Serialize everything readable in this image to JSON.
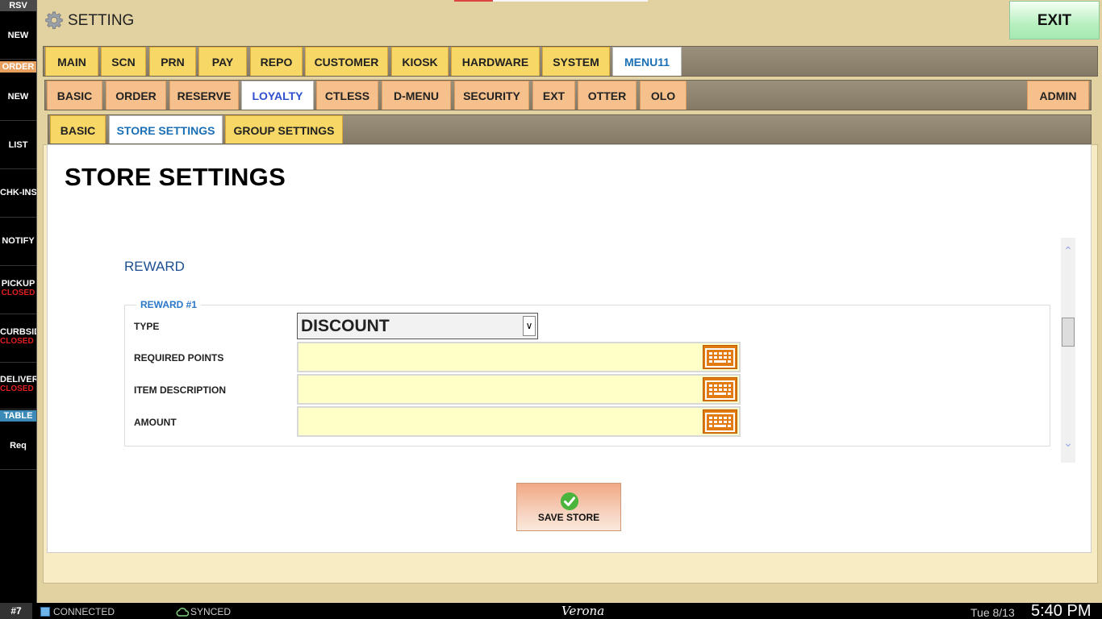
{
  "sidebar": {
    "rsv_header": "RSV",
    "rsv_new": "NEW",
    "order_header": "ORDER",
    "order_items": [
      {
        "label": "NEW",
        "status": ""
      },
      {
        "label": "LIST",
        "status": ""
      },
      {
        "label": "CHK-INS",
        "status": ""
      },
      {
        "label": "NOTIFY",
        "status": ""
      },
      {
        "label": "PICKUP",
        "status": "CLOSED"
      },
      {
        "label": "CURBSID",
        "status": "CLOSED"
      },
      {
        "label": "DELIVERY",
        "status": "CLOSED"
      }
    ],
    "table_header": "TABLE",
    "table_req": "Req"
  },
  "header": {
    "title": "SETTING",
    "exit_label": "EXIT"
  },
  "main_tabs": [
    "MAIN",
    "SCN",
    "PRN",
    "PAY",
    "REPO",
    "CUSTOMER",
    "KIOSK",
    "HARDWARE",
    "SYSTEM",
    "MENU11"
  ],
  "main_tabs_active": "MENU11",
  "sub_tabs": [
    "BASIC",
    "ORDER",
    "RESERVE",
    "LOYALTY",
    "CTLESS",
    "D-MENU",
    "SECURITY",
    "EXT",
    "OTTER",
    "OLO"
  ],
  "sub_tabs_right": "ADMIN",
  "sub_tabs_active": "LOYALTY",
  "loyalty_tabs": [
    "BASIC",
    "STORE SETTINGS",
    "GROUP SETTINGS"
  ],
  "loyalty_tabs_active": "STORE SETTINGS",
  "content": {
    "title": "STORE SETTINGS",
    "section_heading": "REWARD",
    "fieldset_legend": "REWARD #1",
    "fields": {
      "type_label": "TYPE",
      "type_value": "DISCOUNT",
      "required_points_label": "REQUIRED POINTS",
      "required_points_value": "",
      "item_description_label": "ITEM DESCRIPTION",
      "item_description_value": "",
      "amount_label": "AMOUNT",
      "amount_value": ""
    },
    "save_label": "SAVE STORE"
  },
  "status_bar": {
    "terminal": "#7",
    "connection": "CONNECTED",
    "sync": "SYNCED",
    "store_name": "Verona",
    "date": "Tue 8/13",
    "time": "5:40 PM"
  },
  "colors": {
    "background": "#e2d2a2",
    "tab_gold": "#f7d766",
    "tab_peach": "#f6c08c",
    "active_tab_text": "#1a6fb5",
    "input_fill": "#ffffc8",
    "keyboard_button": "#e27a10",
    "closed_status": "#e02020"
  },
  "icons": {
    "settings": "gear-icon",
    "keyboard": "keyboard-icon",
    "save": "checkmark-icon",
    "connected": "network-icon",
    "synced": "cloud-icon"
  }
}
